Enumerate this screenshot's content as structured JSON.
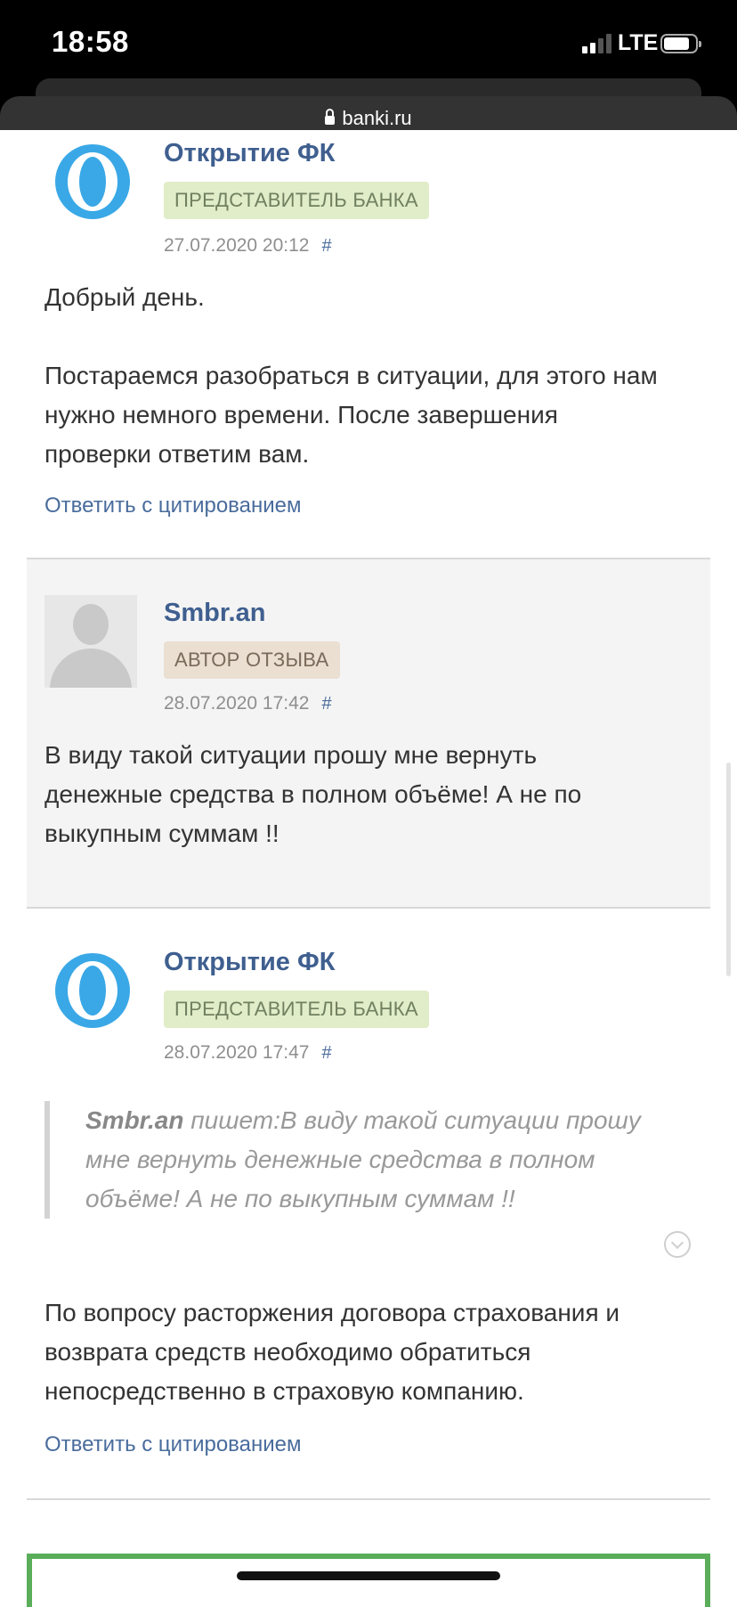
{
  "status_bar": {
    "time": "18:58",
    "network": "LTE",
    "url": "banki.ru"
  },
  "posts": [
    {
      "username": "Открытие ФК",
      "badge": "ПРЕДСТАВИТЕЛЬ БАНКА",
      "date": "27.07.2020 20:12",
      "hash": "#",
      "text": "Добрый день.\n\nПостараемся разобраться в ситуации, для этого нам\nнужно немного времени. После завершения\nпроверки ответим вам.",
      "reply_label": "Ответить с цитированием",
      "avatar_icon": "otkritie-logo-icon"
    },
    {
      "username": "Smbr.an",
      "badge": "АВТОР ОТЗЫВА",
      "date": "28.07.2020 17:42",
      "hash": "#",
      "text": "В виду такой ситуации прошу мне вернуть\nденежные средства в полном объёме! А не по\nвыкупным суммам !!",
      "avatar_icon": "user-placeholder-icon"
    },
    {
      "username": "Открытие ФК",
      "badge": "ПРЕДСТАВИТЕЛЬ БАНКА",
      "date": "28.07.2020 17:47",
      "hash": "#",
      "quote_author": "Smbr.an",
      "quote_verb": " пишет:",
      "quote_text_line1": "В виду такой ситуации прошу",
      "quote_text_rest": "мне вернуть денежные средства в полном\nобъёме! А не по выкупным суммам !!",
      "text": "По вопросу расторжения договора страхования и\nвозврата средств необходимо обратиться\nнепосредственно в страховую компанию.",
      "reply_label": "Ответить с цитированием",
      "avatar_icon": "otkritie-logo-icon"
    }
  ],
  "colors": {
    "link": "#3f5f8f",
    "bank_badge_bg": "#e1ecc8",
    "author_badge_bg": "#eadfd1",
    "author_post_bg": "#f4f4f4",
    "brand": "#3aa8e6",
    "green_border": "#5aae5a"
  }
}
